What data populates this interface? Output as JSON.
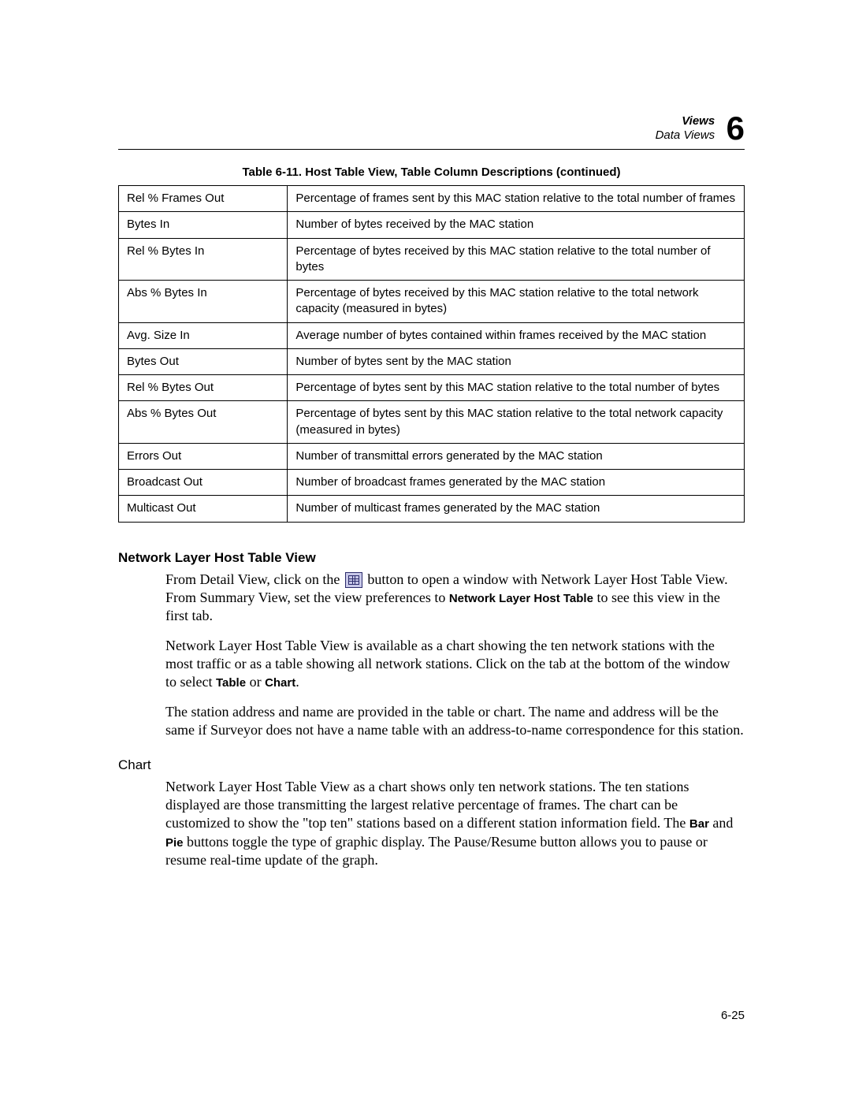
{
  "header": {
    "title": "Views",
    "subtitle": "Data Views",
    "chapter_number": "6"
  },
  "table": {
    "caption": "Table 6-11. Host Table View, Table Column Descriptions (continued)",
    "rows": [
      {
        "name": "Rel % Frames Out",
        "desc": "Percentage of frames sent by this MAC station relative to the total number of frames"
      },
      {
        "name": "Bytes In",
        "desc": "Number of bytes received by the MAC station"
      },
      {
        "name": "Rel % Bytes In",
        "desc": "Percentage of bytes received by this MAC station relative to the total number of bytes"
      },
      {
        "name": "Abs % Bytes In",
        "desc": "Percentage of bytes received by this MAC station relative to the total network capacity (measured in bytes)"
      },
      {
        "name": "Avg. Size In",
        "desc": "Average number of bytes contained within frames received by the MAC station"
      },
      {
        "name": "Bytes Out",
        "desc": "Number of bytes sent by the MAC station"
      },
      {
        "name": "Rel % Bytes Out",
        "desc": "Percentage of bytes sent by this MAC station relative to the total number of bytes"
      },
      {
        "name": "Abs % Bytes Out",
        "desc": "Percentage of bytes sent by this MAC station relative to the total network capacity (measured in bytes)"
      },
      {
        "name": "Errors Out",
        "desc": "Number of transmittal errors generated by the MAC station"
      },
      {
        "name": "Broadcast Out",
        "desc": "Number of broadcast frames generated by the MAC station"
      },
      {
        "name": "Multicast Out",
        "desc": "Number of multicast frames generated by the MAC station"
      }
    ]
  },
  "section": {
    "heading": "Network Layer Host Table View",
    "p1_a": "From Detail View, click on the ",
    "p1_b": " button to open a window with Network Layer Host Table View. From Summary View, set the view preferences to ",
    "p1_bold1": "Network Layer Host Table",
    "p1_c": " to see this view in the first tab.",
    "p2_a": "Network Layer Host Table View is available as a chart showing the ten network stations with the most traffic or as a table showing all network stations. Click on the tab at the bottom of the window to select ",
    "p2_bold_table": "Table",
    "p2_mid": " or ",
    "p2_bold_chart": "Chart",
    "p2_end": ".",
    "p3": "The station address and name are provided in the table or chart. The name and address will be the same if Surveyor does not have a name table with an address-to-name correspondence for this station.",
    "chart_heading": "Chart",
    "p4_a": "Network Layer Host Table View as a chart shows only ten network stations. The ten stations displayed are those transmitting the largest relative percentage of frames. The chart can be customized to show the \"top ten\" stations based on a different station information field. The ",
    "p4_bold_bar": "Bar",
    "p4_mid1": " and ",
    "p4_bold_pie": "Pie",
    "p4_b": " buttons toggle the type of graphic display. The Pause/Resume button allows you to pause or resume real-time update of the graph."
  },
  "page_number": "6-25"
}
